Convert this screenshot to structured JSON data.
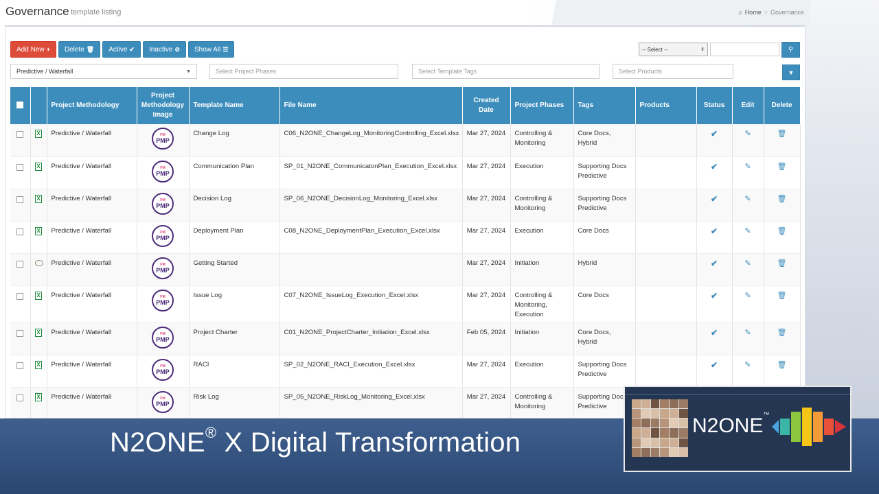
{
  "header": {
    "title": "Governance",
    "subtitle": "template listing",
    "breadcrumb": [
      "Home",
      "Governance"
    ]
  },
  "toolbar": {
    "add_new": "Add New",
    "delete": "Delete",
    "active": "Active",
    "inactive": "Inactive",
    "show_all": "Show All",
    "select_value": "-- Select --",
    "search_value": ""
  },
  "filters": {
    "methodology": "Predictive / Waterfall",
    "phases_placeholder": "Select Project Phases",
    "tags_placeholder": "Select Template Tags",
    "products_placeholder": "Select Products"
  },
  "table": {
    "columns": [
      "Project Methodology",
      "Project Methodology Image",
      "Template Name",
      "File Name",
      "Created Date",
      "Project Phases",
      "Tags",
      "Products",
      "Status",
      "Edit",
      "Delete"
    ],
    "rows": [
      {
        "type": "excel",
        "methodology": "Predictive / Waterfall",
        "template": "Change Log",
        "file": "C06_N2ONE_ChangeLog_MonitoringControlling_Excel.xlsx",
        "date": "Mar 27, 2024",
        "phases": "Controlling & Monitoring",
        "tags": "Core Docs, Hybrid",
        "products": ""
      },
      {
        "type": "excel",
        "methodology": "Predictive / Waterfall",
        "template": "Communication Plan",
        "file": "SP_01_N2ONE_CommunicatonPlan_Execution_Excel.xlsx",
        "date": "Mar 27, 2024",
        "phases": "Execution",
        "tags": "Supporting Docs Predictive",
        "products": ""
      },
      {
        "type": "excel",
        "methodology": "Predictive / Waterfall",
        "template": "Decision Log",
        "file": "SP_06_N2ONE_DecisionLog_Monitoring_Excel.xlsx",
        "date": "Mar 27, 2024",
        "phases": "Controlling & Monitoring",
        "tags": "Supporting Docs Predictive",
        "products": ""
      },
      {
        "type": "excel",
        "methodology": "Predictive / Waterfall",
        "template": "Deployment Plan",
        "file": "C08_N2ONE_DeploymentPlan_Execution_Excel.xlsx",
        "date": "Mar 27, 2024",
        "phases": "Execution",
        "tags": "Core Docs",
        "products": ""
      },
      {
        "type": "chat",
        "methodology": "Predictive / Waterfall",
        "template": "Getting Started",
        "file": "",
        "date": "Mar 27, 2024",
        "phases": "Initiation",
        "tags": "Hybrid",
        "products": ""
      },
      {
        "type": "excel",
        "methodology": "Predictive / Waterfall",
        "template": "Issue Log",
        "file": "C07_N2ONE_IssueLog_Execution_Excel.xlsx",
        "date": "Mar 27, 2024",
        "phases": "Controlling & Monitoring, Execution",
        "tags": "Core Docs",
        "products": ""
      },
      {
        "type": "excel",
        "methodology": "Predictive / Waterfall",
        "template": "Project Charter",
        "file": "C01_N2ONE_ProjectCharter_Initiation_Excel.xlsx",
        "date": "Feb 05, 2024",
        "phases": "Initiation",
        "tags": "Core Docs, Hybrid",
        "products": ""
      },
      {
        "type": "excel",
        "methodology": "Predictive / Waterfall",
        "template": "RACI",
        "file": "SP_02_N2ONE_RACI_Execution_Excel.xlsx",
        "date": "Mar 27, 2024",
        "phases": "Execution",
        "tags": "Supporting Docs Predictive",
        "products": ""
      },
      {
        "type": "excel",
        "methodology": "Predictive / Waterfall",
        "template": "Risk Log",
        "file": "SP_05_N2ONE_RiskLog_Monitoring_Excel.xlsx",
        "date": "Mar 27, 2024",
        "phases": "Controlling & Monitoring",
        "tags": "Supporting Docs Predictive",
        "products": ""
      }
    ],
    "pmp_label": "PMP",
    "pmp_top": "PM",
    "icons": {
      "status": "check-icon",
      "edit": "edit-icon",
      "delete": "trash-icon"
    }
  },
  "banner": {
    "title_main": "N2ONE",
    "title_mark": "®",
    "title_rest": " X Digital Transformation"
  },
  "logo": {
    "name": "N2ONE",
    "mark": "™"
  },
  "colors": {
    "primary": "#3c8dbc",
    "danger": "#dd4b39",
    "banner": "#34527f",
    "pmp_purple": "#4b2a7a"
  }
}
